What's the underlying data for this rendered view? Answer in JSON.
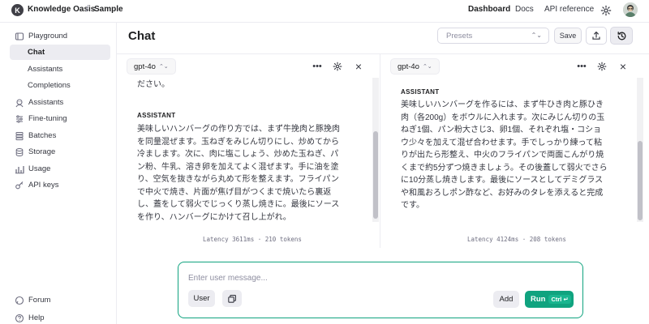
{
  "topbar": {
    "org_initial": "K",
    "org_name": "Knowledge Oasis",
    "separator": "/",
    "project_name": "Sample",
    "nav": {
      "dashboard": "Dashboard",
      "docs": "Docs",
      "api_reference": "API reference"
    }
  },
  "sidebar": {
    "items": [
      {
        "label": "Playground",
        "icon": "playground-icon"
      },
      {
        "label": "Chat",
        "active": true
      },
      {
        "label": "Assistants"
      },
      {
        "label": "Completions"
      },
      {
        "label": "Assistants",
        "icon": "assistants-icon"
      },
      {
        "label": "Fine-tuning",
        "icon": "fine-tuning-icon"
      },
      {
        "label": "Batches",
        "icon": "batches-icon"
      },
      {
        "label": "Storage",
        "icon": "storage-icon"
      },
      {
        "label": "Usage",
        "icon": "usage-icon"
      },
      {
        "label": "API keys",
        "icon": "api-keys-icon"
      }
    ],
    "footer": [
      {
        "label": "Forum",
        "icon": "forum-icon"
      },
      {
        "label": "Help",
        "icon": "help-icon"
      }
    ]
  },
  "header": {
    "title": "Chat",
    "presets_placeholder": "Presets",
    "save_label": "Save"
  },
  "panels": [
    {
      "model": "gpt-4o",
      "cut_line": "ださい。",
      "role": "ASSISTANT",
      "message_lines": [
        "美味しいハンバーグの作り方では、まず牛挽肉と豚挽肉",
        "を同量混ぜます。玉ねぎをみじん切りにし、炒めてから",
        "冷まします。次に、肉に塩こしょう、炒めた玉ねぎ、パ",
        "ン粉、牛乳、溶き卵を加えてよく混ぜます。手に油を塗",
        "り、空気を抜きながら丸めて形を整えます。フライパン",
        "で中火で焼き、片面が焦げ目がつくまで焼いたら裏返",
        "し、蓋をして弱火でじっくり蒸し焼きに。最後にソース",
        "を作り、ハンバーグにかけて召し上がれ。"
      ],
      "stats": "Latency 3611ms · 210 tokens"
    },
    {
      "model": "gpt-4o",
      "role": "ASSISTANT",
      "message_lines": [
        "美味しいハンバーグを作るには、まず牛ひき肉と豚ひき",
        "肉（各200g）をボウルに入れます。次にみじん切りの玉",
        "ねぎ1個、パン粉大さじ3、卵1個、それぞれ塩・コショ",
        "ウ少々を加えて混ぜ合わせます。手でしっかり練って粘",
        "りが出たら形整え、中火のフライパンで両面こんがり焼",
        "くまで約5分ずつ焼きましょう。その後蓋して弱火でさら",
        "に10分蒸し焼きします。最後にソースとしてデミグラス",
        "や和風おろしポン酢など、お好みのタレを添えると完成",
        "です。"
      ],
      "stats": "Latency 4124ms · 208 tokens"
    }
  ],
  "composer": {
    "placeholder": "Enter user message...",
    "role_label": "User",
    "add_label": "Add",
    "run_label": "Run",
    "run_shortcut": "Ctrl ↵"
  },
  "colors": {
    "accent": "#10a37f",
    "border": "#ececf1",
    "text": "#353740"
  }
}
